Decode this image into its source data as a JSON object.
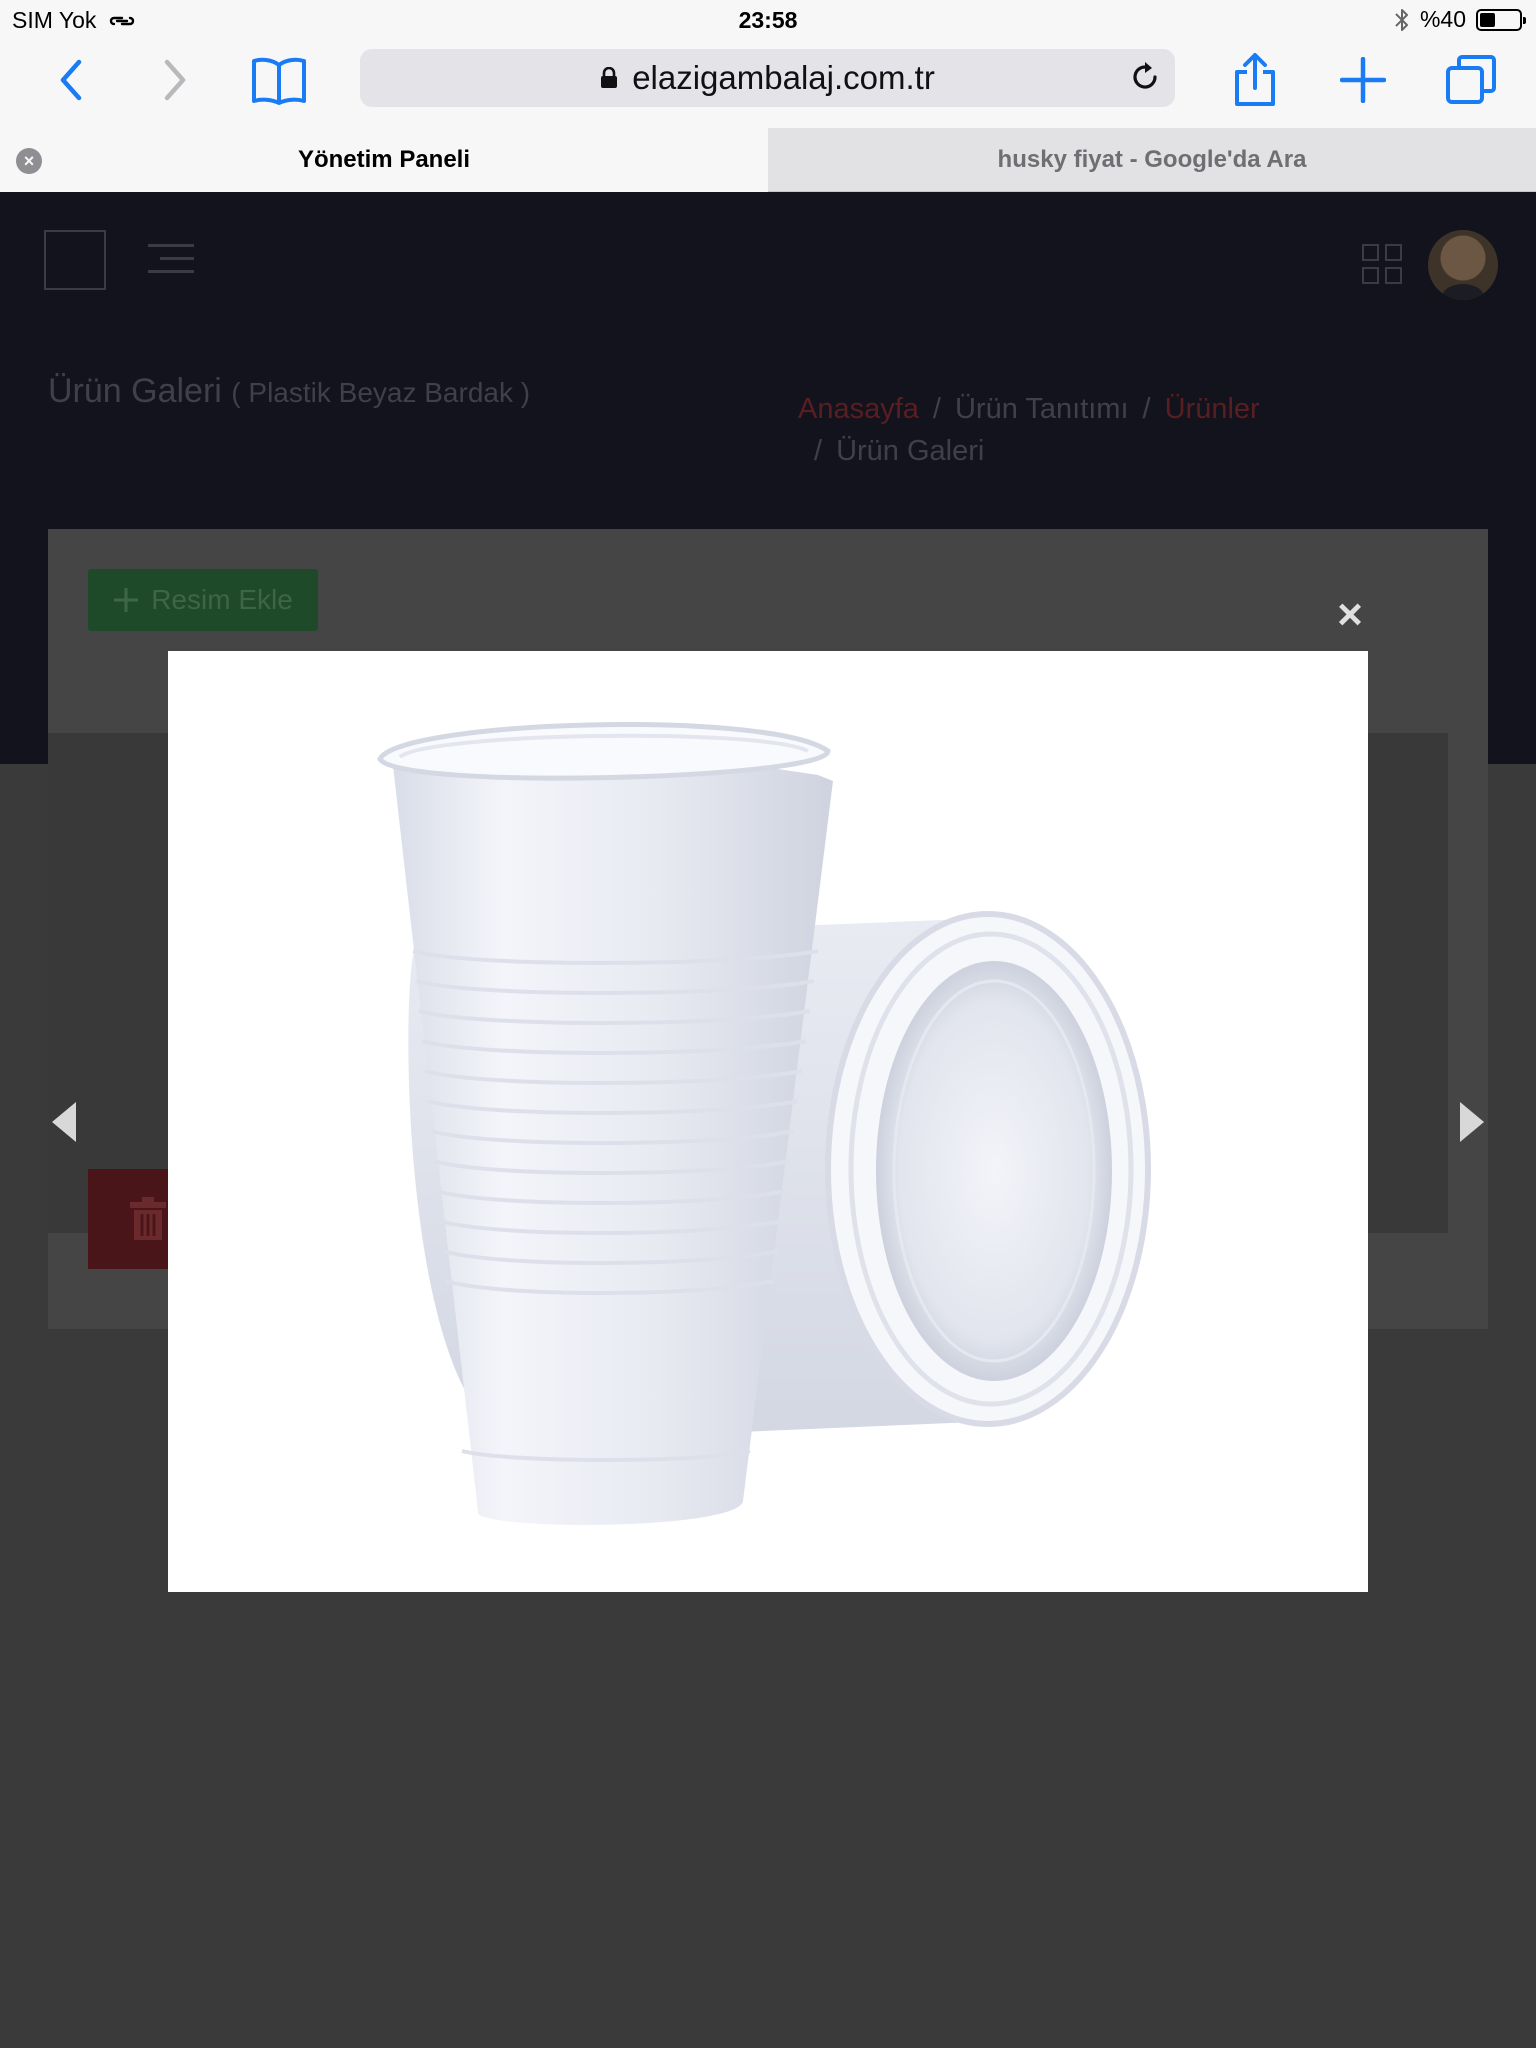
{
  "status_bar": {
    "carrier": "SIM Yok",
    "time": "23:58",
    "battery_text": "%40",
    "battery_level": 0.4,
    "icons": [
      "wifi-link-icon",
      "bluetooth-icon",
      "battery-icon"
    ]
  },
  "browser": {
    "url": "elazigambalaj.com.tr",
    "buttons": [
      "back-icon",
      "forward-icon",
      "bookmarks-icon",
      "reload-icon",
      "share-icon",
      "new-tab-icon",
      "tabs-icon"
    ],
    "accent_color": "#1a7cf5"
  },
  "tabs": [
    {
      "title": "Yönetim Paneli",
      "active": true
    },
    {
      "title": "husky fiyat - Google'da Ara",
      "active": false
    }
  ],
  "page": {
    "title": "Ürün Galeri",
    "subtitle": "( Plastik Beyaz Bardak )",
    "breadcrumb": [
      "Anasayfa",
      "Ürün Tanıtımı",
      "Ürünler",
      "Ürün Galeri"
    ],
    "add_button": "Resim  Ekle",
    "add_icon": "plus-icon",
    "delete_icon": "trash-icon"
  },
  "lightbox": {
    "close_symbol": "×",
    "prev_icon": "triangle-left-icon",
    "next_icon": "triangle-right-icon",
    "image_subject": "two white plastic cups"
  }
}
